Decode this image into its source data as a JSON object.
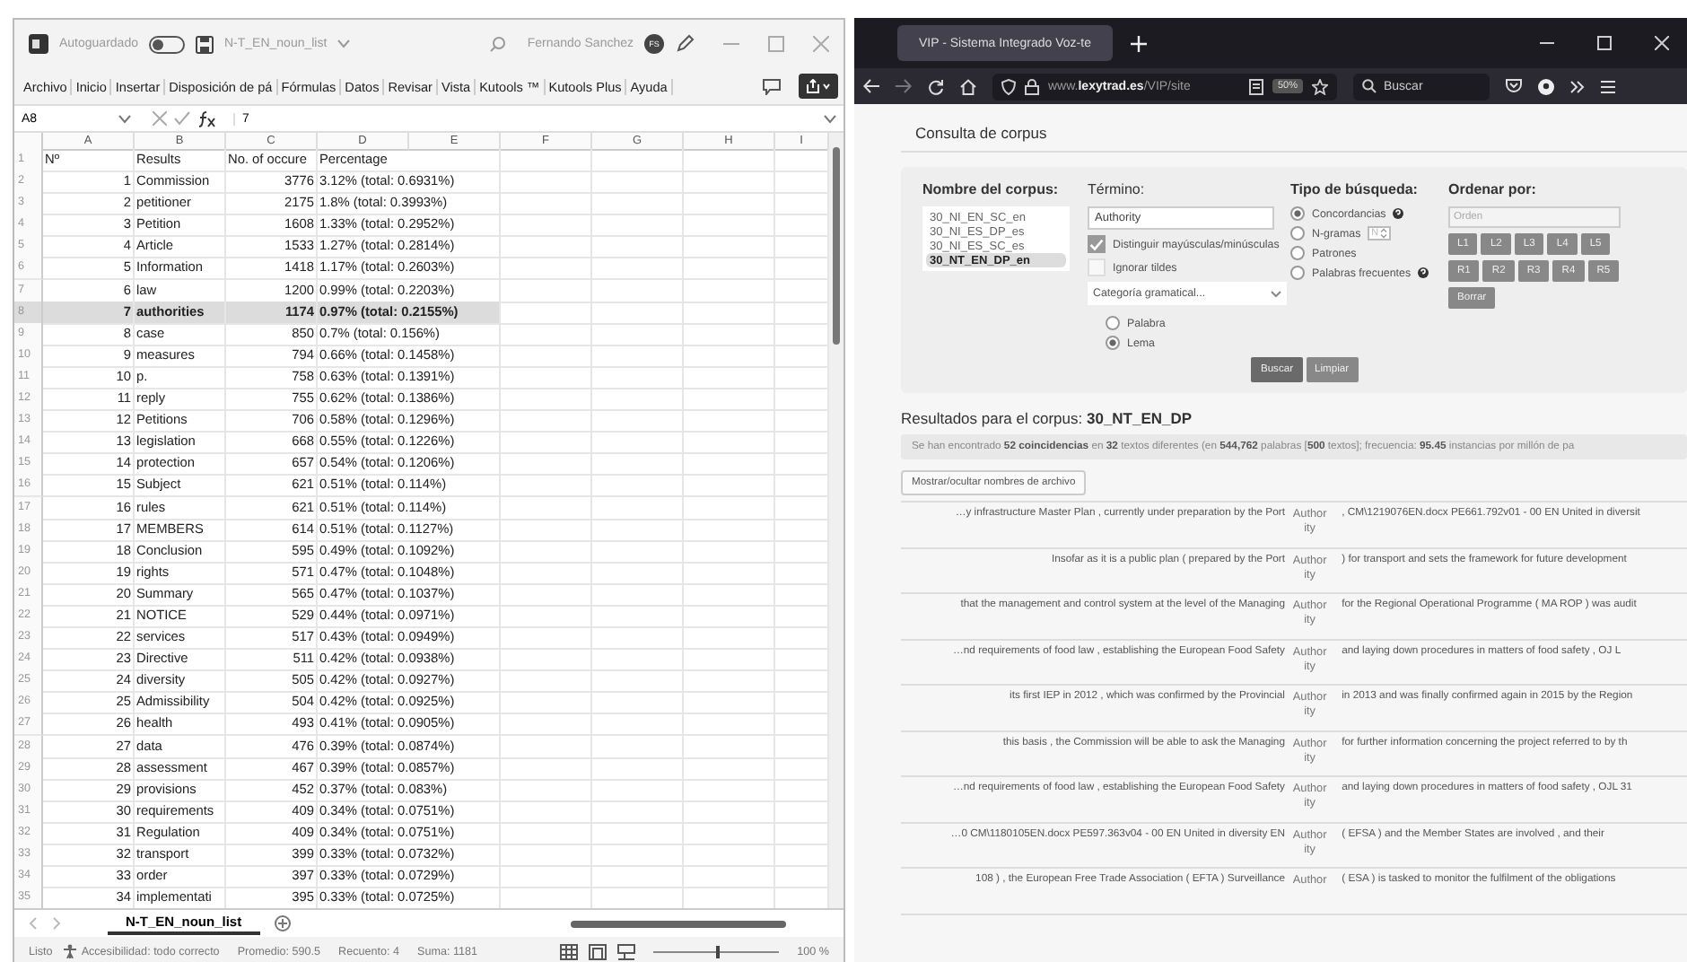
{
  "excel": {
    "title_bar": {
      "autosave_label": "Autoguardado",
      "autosave_on": false,
      "file_name": "N-T_EN_noun_list",
      "user": "Fernando Sanchez",
      "user_initials": "FS"
    },
    "menu_tabs": [
      "Archivo",
      "Inicio",
      "Insertar",
      "Disposición de pá",
      "Fórmulas",
      "Datos",
      "Revisar",
      "Vista",
      "Kutools ™",
      "Kutools Plus",
      "Ayuda"
    ],
    "name_box": "A8",
    "formula": "7",
    "columns": [
      "A",
      "B",
      "C",
      "D",
      "E",
      "F",
      "G",
      "H",
      "I"
    ],
    "rows": [
      {
        "n": "1",
        "kind": "header",
        "cells": [
          "Nº",
          "Results",
          "No. of occure",
          "Percentage"
        ],
        "selected": false
      },
      {
        "n": "2",
        "kind": "data",
        "cells": [
          "1",
          "Commission",
          "3776",
          "3.12% (total: 0.6931%)"
        ],
        "selected": false
      },
      {
        "n": "3",
        "kind": "data",
        "cells": [
          "2",
          "petitioner",
          "2175",
          "1.8% (total: 0.3993%)"
        ],
        "selected": false
      },
      {
        "n": "4",
        "kind": "data",
        "cells": [
          "3",
          "Petition",
          "1608",
          "1.33% (total: 0.2952%)"
        ],
        "selected": false
      },
      {
        "n": "5",
        "kind": "data",
        "cells": [
          "4",
          "Article",
          "1533",
          "1.27% (total: 0.2814%)"
        ],
        "selected": false
      },
      {
        "n": "6",
        "kind": "data",
        "cells": [
          "5",
          "Information",
          "1418",
          "1.17% (total: 0.2603%)"
        ],
        "selected": false
      },
      {
        "n": "7",
        "kind": "data",
        "cells": [
          "6",
          "law",
          "1200",
          "0.99% (total: 0.2203%)"
        ],
        "selected": false
      },
      {
        "n": "8",
        "kind": "data",
        "cells": [
          "7",
          "authorities",
          "1174",
          "0.97% (total: 0.2155%)"
        ],
        "selected": true
      },
      {
        "n": "9",
        "kind": "data",
        "cells": [
          "8",
          "case",
          "850",
          "0.7% (total: 0.156%)"
        ],
        "selected": false
      },
      {
        "n": "10",
        "kind": "data",
        "cells": [
          "9",
          "measures",
          "794",
          "0.66% (total: 0.1458%)"
        ],
        "selected": false
      },
      {
        "n": "11",
        "kind": "data",
        "cells": [
          "10",
          "p.",
          "758",
          "0.63% (total: 0.1391%)"
        ],
        "selected": false
      },
      {
        "n": "12",
        "kind": "data",
        "cells": [
          "11",
          "reply",
          "755",
          "0.62% (total: 0.1386%)"
        ],
        "selected": false
      },
      {
        "n": "13",
        "kind": "data",
        "cells": [
          "12",
          "Petitions",
          "706",
          "0.58% (total: 0.1296%)"
        ],
        "selected": false
      },
      {
        "n": "14",
        "kind": "data",
        "cells": [
          "13",
          "legislation",
          "668",
          "0.55% (total: 0.1226%)"
        ],
        "selected": false
      },
      {
        "n": "15",
        "kind": "data",
        "cells": [
          "14",
          "protection",
          "657",
          "0.54% (total: 0.1206%)"
        ],
        "selected": false
      },
      {
        "n": "16",
        "kind": "data",
        "cells": [
          "15",
          "Subject",
          "621",
          "0.51% (total: 0.114%)"
        ],
        "selected": false
      },
      {
        "n": "17",
        "kind": "data",
        "cells": [
          "16",
          "rules",
          "621",
          "0.51% (total: 0.114%)"
        ],
        "selected": false
      },
      {
        "n": "18",
        "kind": "data",
        "cells": [
          "17",
          "MEMBERS",
          "614",
          "0.51% (total: 0.1127%)"
        ],
        "selected": false
      },
      {
        "n": "19",
        "kind": "data",
        "cells": [
          "18",
          "Conclusion",
          "595",
          "0.49% (total: 0.1092%)"
        ],
        "selected": false
      },
      {
        "n": "20",
        "kind": "data",
        "cells": [
          "19",
          "rights",
          "571",
          "0.47% (total: 0.1048%)"
        ],
        "selected": false
      },
      {
        "n": "21",
        "kind": "data",
        "cells": [
          "20",
          "Summary",
          "565",
          "0.47% (total: 0.1037%)"
        ],
        "selected": false
      },
      {
        "n": "22",
        "kind": "data",
        "cells": [
          "21",
          "NOTICE",
          "529",
          "0.44% (total: 0.0971%)"
        ],
        "selected": false
      },
      {
        "n": "23",
        "kind": "data",
        "cells": [
          "22",
          "services",
          "517",
          "0.43% (total: 0.0949%)"
        ],
        "selected": false
      },
      {
        "n": "24",
        "kind": "data",
        "cells": [
          "23",
          "Directive",
          "511",
          "0.42% (total: 0.0938%)"
        ],
        "selected": false
      },
      {
        "n": "25",
        "kind": "data",
        "cells": [
          "24",
          "diversity",
          "505",
          "0.42% (total: 0.0927%)"
        ],
        "selected": false
      },
      {
        "n": "26",
        "kind": "data",
        "cells": [
          "25",
          "Admissibility",
          "504",
          "0.42% (total: 0.0925%)"
        ],
        "selected": false
      },
      {
        "n": "27",
        "kind": "data",
        "cells": [
          "26",
          "health",
          "493",
          "0.41% (total: 0.0905%)"
        ],
        "selected": false
      },
      {
        "n": "28",
        "kind": "data",
        "cells": [
          "27",
          "data",
          "476",
          "0.39% (total: 0.0874%)"
        ],
        "selected": false
      },
      {
        "n": "29",
        "kind": "data",
        "cells": [
          "28",
          "assessment",
          "467",
          "0.39% (total: 0.0857%)"
        ],
        "selected": false
      },
      {
        "n": "30",
        "kind": "data",
        "cells": [
          "29",
          "provisions",
          "452",
          "0.37% (total: 0.083%)"
        ],
        "selected": false
      },
      {
        "n": "31",
        "kind": "data",
        "cells": [
          "30",
          "requirements",
          "409",
          "0.34% (total: 0.0751%)"
        ],
        "selected": false
      },
      {
        "n": "32",
        "kind": "data",
        "cells": [
          "31",
          "Regulation",
          "409",
          "0.34% (total: 0.0751%)"
        ],
        "selected": false
      },
      {
        "n": "33",
        "kind": "data",
        "cells": [
          "32",
          "transport",
          "399",
          "0.33% (total: 0.0732%)"
        ],
        "selected": false
      },
      {
        "n": "34",
        "kind": "data",
        "cells": [
          "33",
          "order",
          "397",
          "0.33% (total: 0.0729%)"
        ],
        "selected": false
      },
      {
        "n": "35",
        "kind": "data",
        "cells": [
          "34",
          "implementati",
          "395",
          "0.33% (total: 0.0725%)"
        ],
        "selected": false
      }
    ],
    "sheet_tab": "N-T_EN_noun_list",
    "status": {
      "ready": "Listo",
      "accessibility": "Accesibilidad: todo correcto",
      "stats": [
        "Promedio: 590.5",
        "Recuento: 4",
        "Suma: 1181"
      ],
      "zoom": "100 %",
      "level": 0.5
    }
  },
  "browser": {
    "tab_title": "VIP - Sistema Integrado Voz-te",
    "url": "www.**lexytrad.es**/VIP/site",
    "page_zoom": "50%",
    "search_placeholder": "Buscar",
    "page": {
      "heading": "Consulta de corpus",
      "corpus_label": "Nombre del corpus:",
      "corpora": [
        {
          "name": "30_NI_EN_SC_en",
          "selected": false
        },
        {
          "name": "30_NI_ES_DP_es",
          "selected": false
        },
        {
          "name": "30_NI_ES_SC_es",
          "selected": false
        },
        {
          "name": "30_NT_EN_DP_en",
          "selected": true
        }
      ],
      "term_label": "Término:",
      "term_value": "Authority",
      "checkboxes": [
        {
          "label": "Distinguir mayúsculas/minúsculas",
          "checked": true
        },
        {
          "label": "Ignorar tildes",
          "checked": false
        }
      ],
      "category_placeholder": "Categoría gramatical...",
      "units": [
        {
          "label": "Palabra",
          "selected": false
        },
        {
          "label": "Lema",
          "selected": true
        }
      ],
      "type_label": "Tipo de búsqueda:",
      "search_types": [
        {
          "label": "Concordancias",
          "selected": true,
          "kind": "help"
        },
        {
          "label": "N-gramas",
          "selected": false,
          "kind": "spinner",
          "spinner_placeholder": "N"
        },
        {
          "label": "Patrones",
          "selected": false,
          "kind": "plain"
        },
        {
          "label": "Palabras frecuentes",
          "selected": false,
          "kind": "help"
        }
      ],
      "order_label": "Ordenar por:",
      "order_placeholder": "Orden",
      "order_left": [
        "L1",
        "L2",
        "L3",
        "L4",
        "L5"
      ],
      "order_right": [
        "R1",
        "R2",
        "R3",
        "R4",
        "R5"
      ],
      "order_clear": "Borrar",
      "actions": [
        "Buscar",
        "Limpiar"
      ],
      "results_title": "Resultados para el corpus: **30_NT_EN_DP**",
      "summary": "Se han encontrado **52 coincidencias** en **32** textos diferentes (en **544,762** palabras [**500** textos]; frecuencia: **95.45** instancias por millón de pa",
      "toggle_button": "Mostrar/ocultar nombres de archivo",
      "concordances": [
        {
          "left": "…y infrastructure Master Plan , currently under preparation by the Port",
          "keyword": "Authority",
          "right": ", CM\\1219076EN.docx PE661.792v01 - 00 EN United in diversit"
        },
        {
          "left": "Insofar as it is a public plan ( prepared by the Port",
          "keyword": "Authority",
          "right": ") for transport and sets the framework for future development"
        },
        {
          "left": "that the management and control system at the level of the Managing",
          "keyword": "Authority",
          "right": "for the Regional Operational Programme ( MA ROP ) was audit"
        },
        {
          "left": "…nd requirements of food law , establishing the European Food Safety",
          "keyword": "Authority",
          "right": "and laying down procedures in matters of food safety , OJ L"
        },
        {
          "left": "its first IEP in 2012 , which was confirmed by the Provincial",
          "keyword": "Authority",
          "right": "in 2013 and was finally confirmed again in 2015 by the Region"
        },
        {
          "left": "this basis , the Commission will be able to ask the Managing",
          "keyword": "Authority",
          "right": "for further information concerning the project referred to by th"
        },
        {
          "left": "…nd requirements of food law , establishing the European Food Safety",
          "keyword": "Authority",
          "right": "and laying down procedures in matters of food safety , OJL 31"
        },
        {
          "left": "…0 CM\\1180105EN.docx PE597.363v04 - 00 EN United in diversity EN",
          "keyword": "Authority",
          "right": "( EFSA ) and the Member States are involved , and their"
        },
        {
          "left": "108 ) , the European Free Trade Association ( EFTA ) Surveillance",
          "keyword": "Author",
          "right": "( ESA ) is tasked to monitor the fulfilment of the obligations"
        }
      ]
    }
  }
}
